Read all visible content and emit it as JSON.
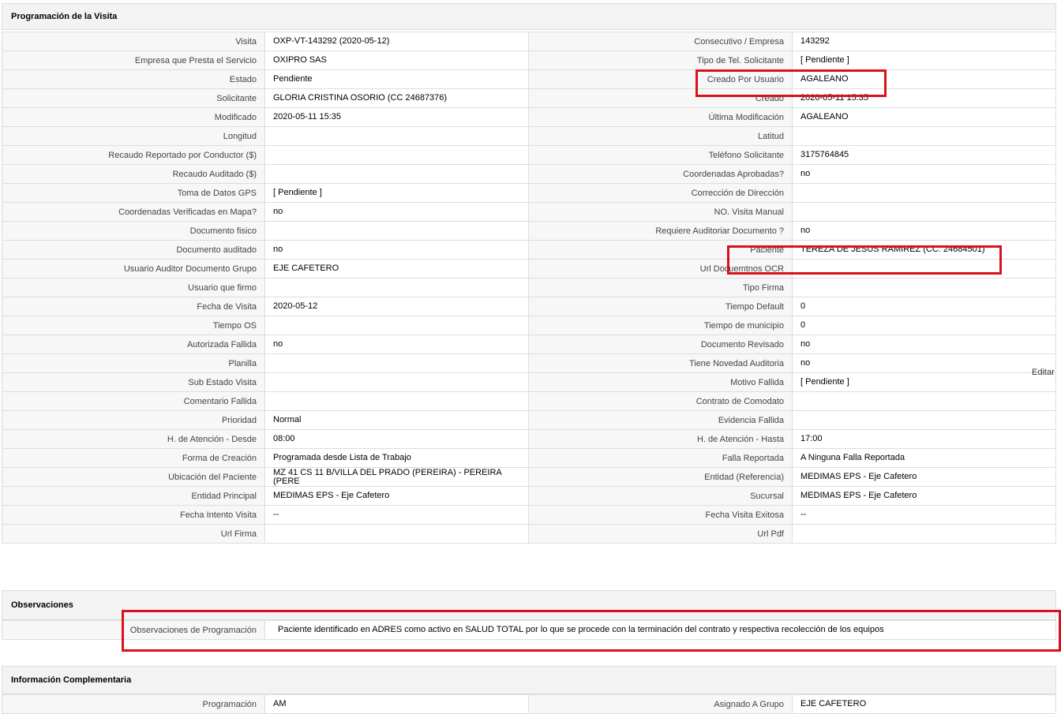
{
  "sections": {
    "programacion": "Programación de la Visita",
    "observaciones": "Observaciones",
    "complementaria": "Información Complementaria"
  },
  "edit_label": "Editar",
  "rows": [
    {
      "l1": "Visita",
      "v1": "OXP-VT-143292 (2020-05-12)",
      "l2": "Consecutivo / Empresa",
      "v2": "143292"
    },
    {
      "l1": "Empresa que Presta el Servicio",
      "v1": "OXIPRO SAS",
      "l2": "Tipo de Tel. Solicitante",
      "v2": "[ Pendiente ]"
    },
    {
      "l1": "Estado",
      "v1": "Pendiente",
      "l2": "Creado Por Usuario",
      "v2": "AGALEANO"
    },
    {
      "l1": "Solicitante",
      "v1": "GLORIA CRISTINA OSORIO (CC 24687376)",
      "l2": "Creado",
      "v2": "2020-05-11 15:35"
    },
    {
      "l1": "Modificado",
      "v1": "2020-05-11 15:35",
      "l2": "Última Modificación",
      "v2": " AGALEANO"
    },
    {
      "l1": "Longitud",
      "v1": "",
      "l2": "Latitud",
      "v2": ""
    },
    {
      "l1": "Recaudo Reportado por Conductor ($)",
      "v1": "",
      "l2": "Teléfono Solicitante",
      "v2": "3175764845"
    },
    {
      "l1": "Recaudo Auditado ($)",
      "v1": "",
      "l2": "Coordenadas Aprobadas?",
      "v2": " no"
    },
    {
      "l1": "Toma de Datos GPS",
      "v1": "[ Pendiente ]",
      "l2": "Corrección de Dirección",
      "v2": ""
    },
    {
      "l1": "Coordenadas Verificadas en Mapa?",
      "v1": " no",
      "l2": "NO. Visita Manual",
      "v2": ""
    },
    {
      "l1": "Documento fisico",
      "v1": "",
      "l2": "Requiere Auditoriar Documento ?",
      "v2": " no"
    },
    {
      "l1": "Documento auditado",
      "v1": " no",
      "l2": "Paciente",
      "v2": "TEREZA DE JESUS RAMIREZ (CC: 24684501)"
    },
    {
      "l1": "Usuario Auditor Documento Grupo",
      "v1": "EJE CAFETERO",
      "l2": "Url Docuemtnos OCR",
      "v2": ""
    },
    {
      "l1": "Usuario que firmo",
      "v1": "",
      "l2": "Tipo Firma",
      "v2": ""
    },
    {
      "l1": "Fecha de Visita",
      "v1": " 2020-05-12",
      "l2": "Tiempo Default",
      "v2": "0"
    },
    {
      "l1": "Tiempo OS",
      "v1": "",
      "l2": "Tiempo de municipio",
      "v2": "0"
    },
    {
      "l1": "Autorizada Fallida",
      "v1": " no",
      "l2": "Documento Revisado",
      "v2": " no"
    },
    {
      "l1": "Planilla",
      "v1": "",
      "l2": "Tiene Novedad Auditoria",
      "v2": " no"
    },
    {
      "l1": "Sub Estado Visita",
      "v1": "",
      "l2": "Motivo Fallida",
      "v2": "[ Pendiente ]"
    },
    {
      "l1": "Comentario Fallida",
      "v1": "",
      "l2": "Contrato de Comodato",
      "v2": ""
    },
    {
      "l1": "Prioridad",
      "v1": "Normal",
      "l2": "Evidencia Fallida",
      "v2": ""
    },
    {
      "l1": "H. de Atención - Desde",
      "v1": "08:00",
      "l2": "H. de Atención - Hasta",
      "v2": "17:00"
    },
    {
      "l1": "Forma de Creación",
      "v1": "Programada desde Lista de Trabajo",
      "l2": "Falla Reportada",
      "v2": "A Ninguna Falla Reportada"
    },
    {
      "l1": "Ubicación del Paciente",
      "v1": "MZ 41 CS 11 B/VILLA DEL PRADO (PEREIRA) - PEREIRA (PERE",
      "l2": "Entidad (Referencia)",
      "v2": "MEDIMAS EPS - Eje Cafetero"
    },
    {
      "l1": "Entidad Principal",
      "v1": "MEDIMAS EPS - Eje Cafetero",
      "l2": "Sucursal",
      "v2": "MEDIMAS EPS - Eje Cafetero"
    },
    {
      "l1": "Fecha Intento Visita",
      "v1": "--",
      "l2": "Fecha Visita Exitosa",
      "v2": " --"
    },
    {
      "l1": "Url Firma",
      "v1": "",
      "l2": "Url Pdf",
      "v2": ""
    }
  ],
  "observaciones": {
    "label": "Observaciones de Programación",
    "value": "Paciente identificado en ADRES como activo en SALUD TOTAL por lo que se procede con la terminación del contrato y respectiva recolección de los equipos"
  },
  "complementaria_rows": [
    {
      "l1": "Programación",
      "v1": "AM",
      "l2": "Asignado A Grupo",
      "v2": "EJE CAFETERO"
    }
  ]
}
